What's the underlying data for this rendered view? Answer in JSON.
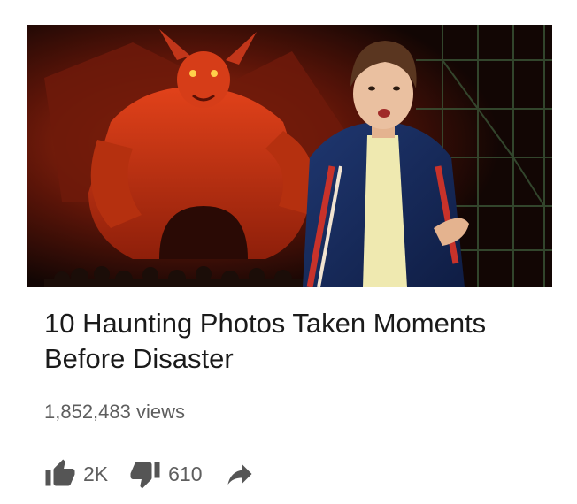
{
  "video": {
    "title": "10 Haunting Photos Taken Moments Before Disaster",
    "views": "1,852,483 views",
    "likes": "2K",
    "dislikes": "610"
  },
  "icons": {
    "like": "thumbs-up-icon",
    "dislike": "thumbs-down-icon",
    "share": "share-arrow-icon"
  },
  "colors": {
    "title": "#1a1a1a",
    "meta": "#5e5e5e",
    "icon": "#555555"
  }
}
